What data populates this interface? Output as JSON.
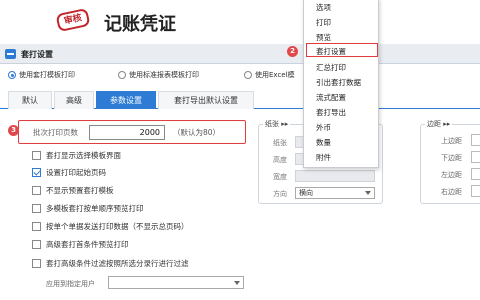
{
  "header": {
    "stamp_text": "审核",
    "doc_title": "记账凭证"
  },
  "dialog": {
    "title": "套打设置"
  },
  "mode_options": [
    {
      "label": "使用套打模板打印",
      "selected": true
    },
    {
      "label": "使用标准报表模板打印",
      "selected": false
    },
    {
      "label": "使用Excel模",
      "selected": false
    }
  ],
  "tabs": [
    {
      "label": "默认",
      "active": false
    },
    {
      "label": "高级",
      "active": false
    },
    {
      "label": "参数设置",
      "active": true
    },
    {
      "label": "套打导出默认设置",
      "active": false
    }
  ],
  "copies": {
    "label": "批次打印页数",
    "value": "2000",
    "hint": "（默认为80）"
  },
  "options": [
    {
      "label": "套打显示选择模板界面",
      "checked": false
    },
    {
      "label": "设置打印起始页码",
      "checked": true
    },
    {
      "label": "不显示预置套打模板",
      "checked": false
    },
    {
      "label": "多模板套打按单顺序预览打印",
      "checked": false
    },
    {
      "label": "按单个单据发送打印数据（不显示总页码）",
      "checked": false
    },
    {
      "label": "高级套打首条件预览打印",
      "checked": false
    },
    {
      "label": "套打高级条件过滤按照所选分录行进行过滤",
      "checked": false
    }
  ],
  "apply_user": {
    "label": "应用到指定用户",
    "value": ""
  },
  "paper": {
    "legend": "纸张 ▸▸",
    "fields": [
      "纸张",
      "高度",
      "宽度",
      "方向"
    ],
    "direction_value": "横向"
  },
  "margins": {
    "legend": "边距 ▸▸",
    "fields": [
      "上边距",
      "下边距",
      "左边距",
      "右边距"
    ]
  },
  "menu": {
    "items": [
      "选项",
      "打印",
      "预览",
      "套打设置",
      "汇总打印",
      "引出套打数据",
      "流式配置",
      "套打导出",
      "外币",
      "数量",
      "附件"
    ],
    "highlighted_index": 3
  },
  "markers": [
    "2",
    "3"
  ],
  "colors": {
    "accent": "#2d7bd4",
    "marker": "#e0484b",
    "highlight_border": "#e23c3c"
  }
}
